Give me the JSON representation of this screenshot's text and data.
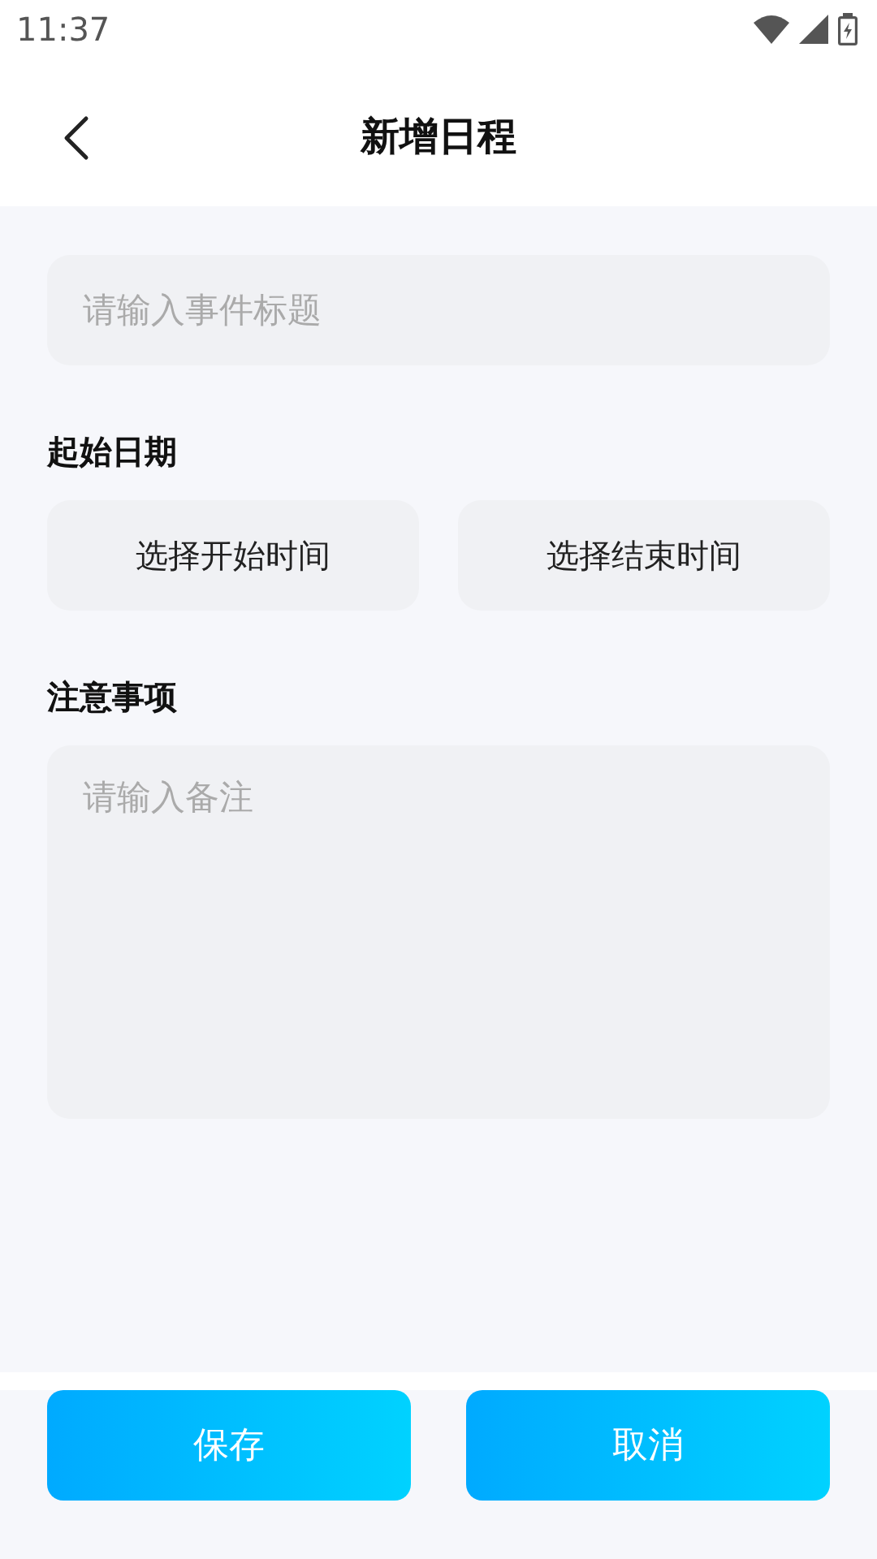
{
  "status_bar": {
    "time": "11:37"
  },
  "header": {
    "title": "新增日程"
  },
  "title_field": {
    "placeholder": "请输入事件标题"
  },
  "date_section": {
    "label": "起始日期",
    "buttons": [
      "选择开始时间",
      "选择结束时间"
    ]
  },
  "notes_section": {
    "label": "注意事项",
    "placeholder": "请输入备注"
  },
  "actions": [
    "保存",
    "取消"
  ]
}
